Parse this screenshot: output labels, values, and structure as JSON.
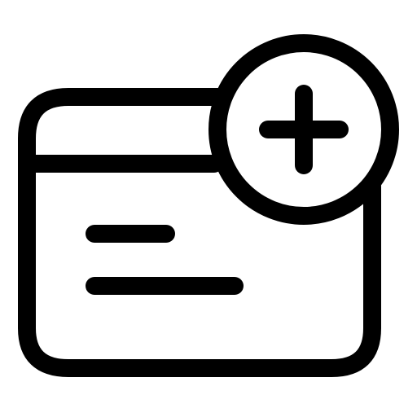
{
  "icon": {
    "name": "add-window-icon",
    "stroke_color": "#000000",
    "background_color": "#ffffff",
    "parts": {
      "window": "browser-window-outline",
      "title_bar": "window-title-bar-divider",
      "content": [
        "text-line-short",
        "text-line-long"
      ],
      "badge": "plus-in-circle"
    }
  }
}
